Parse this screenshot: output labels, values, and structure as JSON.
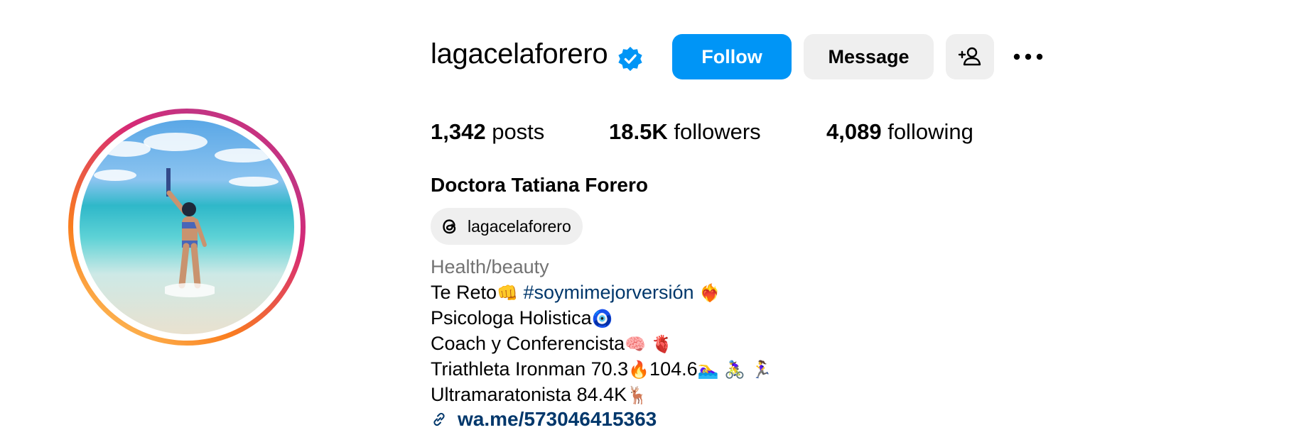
{
  "profile": {
    "username": "lagacelaforero",
    "full_name": "Doctora Tatiana Forero",
    "verified_icon": "verified-badge-icon"
  },
  "actions": {
    "follow_label": "Follow",
    "message_label": "Message",
    "add_user_icon": "person-add-icon",
    "more_icon": "more-options-icon"
  },
  "stats": {
    "posts_count": "1,342",
    "posts_label": "posts",
    "followers_count": "18.5K",
    "followers_label": "followers",
    "following_count": "4,089",
    "following_label": "following"
  },
  "threads": {
    "handle": "lagacelaforero",
    "icon": "threads-icon"
  },
  "bio": {
    "category": "Health/beauty",
    "line1_text": "Te Reto",
    "line1_emoji1": "👊",
    "line1_hashtag": "#soymimejorversión",
    "line1_emoji2": "❤️‍🔥",
    "line2_text": "Psicologa Holistica",
    "line2_emoji": "🧿",
    "line3_text": "Coach y Conferencista",
    "line3_emoji": "🧠 🫀",
    "line4_text": "Triathleta Ironman 70.3",
    "line4_emoji1": "🔥",
    "line4_text2": "104.6",
    "line4_emoji2": "🏊‍♀️ 🚴‍♀️ 🏃‍♀️",
    "line5_text": "Ultramaratonista 84.4K",
    "line5_emoji": "🦌",
    "link_text": "wa.me/573046415363",
    "link_icon": "link-icon"
  },
  "colors": {
    "follow_button": "#0095f6",
    "secondary_button": "#efefef",
    "link": "#00376b",
    "category": "#737373",
    "verified": "#0095f6"
  }
}
